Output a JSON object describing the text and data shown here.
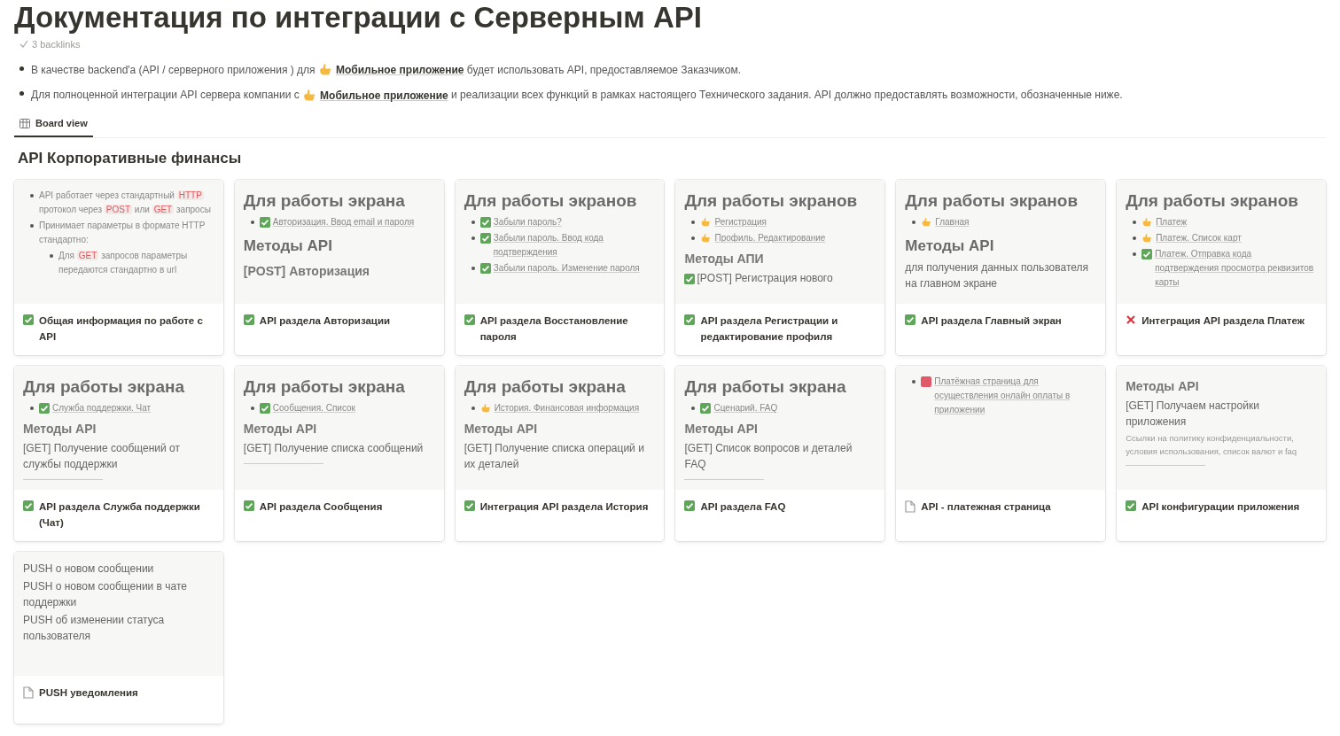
{
  "title": "Документация по интеграции с Серверным API",
  "backlinks": "3 backlinks",
  "intro": [
    {
      "before": "В качестве backend'a (API / серверного приложения ) для",
      "link": "Мобильное приложение",
      "after": "будет использовать API, предоставляемое Заказчиком."
    },
    {
      "before": "Для полноценной интеграции API сервера компании с",
      "link": "Мобильное приложение",
      "after": "и реализации всех функций в рамках настоящего Технического задания. API должно предоставлять возможности, обозначенные ниже."
    }
  ],
  "view_tab": {
    "label": "Board view",
    "selected": true
  },
  "board": {
    "title": "API Корпоративные финансы",
    "cards": [
      {
        "kind": "task",
        "done": true,
        "title": "Общая информация по работе с API",
        "preview": [
          {
            "kind": "bullet",
            "parts": [
              {
                "text": "API работает через стандартный "
              },
              {
                "text": "HTTP",
                "code": true
              },
              {
                "text": " протокол через "
              },
              {
                "text": "POST",
                "code": true
              },
              {
                "text": " или "
              },
              {
                "text": "GET",
                "code": true
              },
              {
                "text": " запросы"
              }
            ]
          },
          {
            "kind": "bullet",
            "parts": [
              {
                "text": "Принимает параметры в формате HTTP стандартно:"
              }
            ],
            "children": [
              {
                "kind": "bullet",
                "parts": [
                  {
                    "text": "Для "
                  },
                  {
                    "text": "GET",
                    "code": true
                  },
                  {
                    "text": " запросов параметры передаются стандартно в url"
                  }
                ]
              }
            ]
          }
        ]
      },
      {
        "kind": "task",
        "done": true,
        "title": "API раздела Авторизации",
        "preview": [
          {
            "kind": "h1",
            "text": "Для работы экрана"
          },
          {
            "kind": "task-mention",
            "parts": [
              {
                "text": "Авторизация. Ввод email и пароля"
              }
            ]
          },
          {
            "kind": "h2",
            "text": "Методы API"
          },
          {
            "kind": "h3",
            "text": "[POST] Авторизация"
          }
        ]
      },
      {
        "kind": "task",
        "done": true,
        "title": "API раздела Восстановление пароля",
        "preview": [
          {
            "kind": "h1",
            "text": "Для работы экранов"
          },
          {
            "kind": "task-mention",
            "parts": [
              {
                "text": "Забыли пароль?"
              }
            ]
          },
          {
            "kind": "task-mention",
            "parts": [
              {
                "text": "Забыли пароль. Ввод кода подтверждения"
              }
            ]
          },
          {
            "kind": "task-mention",
            "parts": [
              {
                "text": "Забыли пароль. Изменение пароля"
              }
            ]
          }
        ]
      },
      {
        "kind": "task",
        "done": true,
        "title": "API раздела Регистрации и редактирование профиля",
        "preview": [
          {
            "kind": "h1",
            "text": "Для работы экранов"
          },
          {
            "kind": "hand-mention",
            "parts": [
              {
                "text": "Регистрация"
              }
            ]
          },
          {
            "kind": "hand-mention",
            "parts": [
              {
                "text": "Профиль. Редактирование"
              }
            ]
          },
          {
            "kind": "h3",
            "text": "Методы АПИ"
          },
          {
            "kind": "task-text",
            "text": "[POST] Регистрация нового"
          }
        ]
      },
      {
        "kind": "task",
        "done": true,
        "title": "API раздела Главный экран",
        "preview": [
          {
            "kind": "h1",
            "text": "Для работы экранов"
          },
          {
            "kind": "hand-mention",
            "parts": [
              {
                "text": "Главная"
              }
            ]
          },
          {
            "kind": "h2",
            "text": "Методы API"
          },
          {
            "kind": "p",
            "text": "для получения данных пользователя на главном экране"
          }
        ]
      },
      {
        "kind": "task",
        "done": false,
        "title": "Интеграция API раздела Платеж",
        "preview": [
          {
            "kind": "h1",
            "text": "Для работы экранов"
          },
          {
            "kind": "hand-mention",
            "parts": [
              {
                "text": "Платеж"
              }
            ]
          },
          {
            "kind": "hand-mention",
            "parts": [
              {
                "text": "Платеж. Список карт"
              }
            ]
          },
          {
            "kind": "task-mention",
            "parts": [
              {
                "text": "Платеж. Отправка кода подтверждения просмотра реквизитов карты"
              }
            ]
          }
        ]
      },
      {
        "kind": "task",
        "done": true,
        "title": "API раздела Служба поддержки (Чат)",
        "preview": [
          {
            "kind": "h1",
            "text": "Для работы экрана"
          },
          {
            "kind": "task-mention",
            "parts": [
              {
                "text": "Служба поддержки. Чат"
              }
            ]
          },
          {
            "kind": "h3",
            "text": "Методы API"
          },
          {
            "kind": "p",
            "text": "[GET] Получение сообщений от службы поддержки"
          },
          {
            "kind": "divider"
          }
        ]
      },
      {
        "kind": "task",
        "done": true,
        "title": "API раздела Сообщения",
        "preview": [
          {
            "kind": "h1",
            "text": "Для работы экрана"
          },
          {
            "kind": "task-mention",
            "parts": [
              {
                "text": "Сообщения. Список"
              }
            ]
          },
          {
            "kind": "h3",
            "text": "Методы API"
          },
          {
            "kind": "p",
            "text": "[GET] Получение списка сообщений"
          },
          {
            "kind": "divider"
          }
        ]
      },
      {
        "kind": "task",
        "done": true,
        "title": "Интеграция API раздела История",
        "preview": [
          {
            "kind": "h1",
            "text": "Для работы экрана"
          },
          {
            "kind": "hand-mention",
            "parts": [
              {
                "text": "История. Финансовая информация"
              }
            ]
          },
          {
            "kind": "h3",
            "text": "Методы API"
          },
          {
            "kind": "p",
            "text": "[GET] Получение списка операций и их деталей"
          }
        ]
      },
      {
        "kind": "task",
        "done": true,
        "title": "API раздела FAQ",
        "preview": [
          {
            "kind": "h1",
            "text": "Для работы экрана"
          },
          {
            "kind": "task-mention",
            "parts": [
              {
                "text": "Сценарий. FAQ"
              }
            ]
          },
          {
            "kind": "h3",
            "text": "Методы API"
          },
          {
            "kind": "p",
            "text": "[GET] Список вопросов и деталей FAQ"
          },
          {
            "kind": "divider"
          }
        ]
      },
      {
        "kind": "page",
        "title": "API - платежная страница",
        "preview": [
          {
            "kind": "pp-mention",
            "parts": [
              {
                "text": "Платёжная страница для осуществления онлайн оплаты в приложении"
              }
            ]
          }
        ]
      },
      {
        "kind": "task",
        "done": true,
        "title": "API конфигурации приложения",
        "preview": [
          {
            "kind": "h3",
            "text": "Методы API"
          },
          {
            "kind": "p",
            "text": "[GET] Получаем настройки приложения"
          },
          {
            "kind": "small",
            "text": "Ссылки на политику конфиденциальности, условия использования, список валют и faq"
          },
          {
            "kind": "divider"
          }
        ]
      },
      {
        "kind": "page",
        "title": "PUSH уведомления",
        "preview": [
          {
            "kind": "p",
            "text": "PUSH о новом сообщении"
          },
          {
            "kind": "p",
            "text": "PUSH о новом сообщении в чате поддержки"
          },
          {
            "kind": "p",
            "text": "PUSH об изменении статуса пользователя"
          }
        ]
      }
    ]
  }
}
